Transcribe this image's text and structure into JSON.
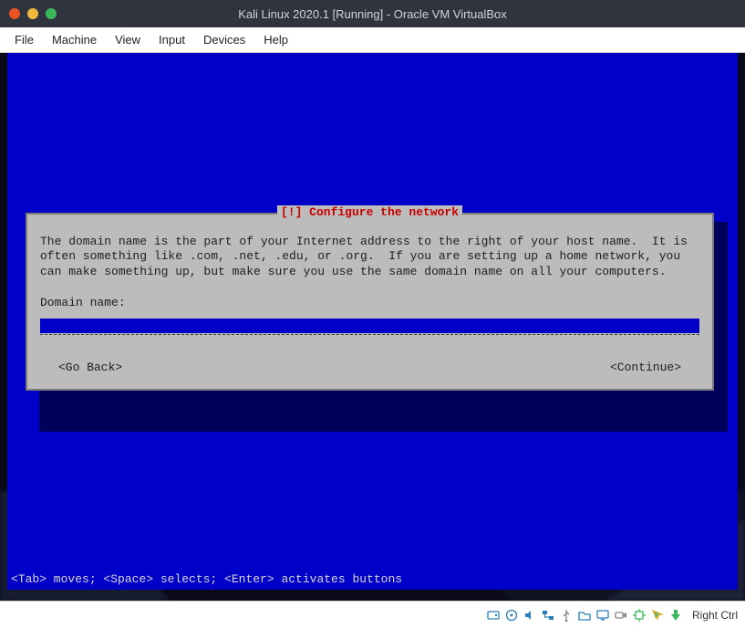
{
  "window": {
    "title": "Kali Linux 2020.1 [Running] - Oracle VM VirtualBox"
  },
  "menu": {
    "file": "File",
    "machine": "Machine",
    "view": "View",
    "input": "Input",
    "devices": "Devices",
    "help": "Help"
  },
  "dialog": {
    "title": "[!] Configure the network",
    "text": "The domain name is the part of your Internet address to the right of your host name.  It is often something like .com, .net, .edu, or .org.  If you are setting up a home network, you can make something up, but make sure you use the same domain name on all your computers.",
    "label": "Domain name:",
    "input_value": "",
    "go_back": "<Go Back>",
    "continue": "<Continue>"
  },
  "hint": "<Tab> moves; <Space> selects; <Enter> activates buttons",
  "status": {
    "host_key": "Right Ctrl"
  },
  "colors": {
    "installer_bg": "#0000c8",
    "dialog_bg": "#bcbcbc",
    "dialog_title": "#c80000"
  }
}
